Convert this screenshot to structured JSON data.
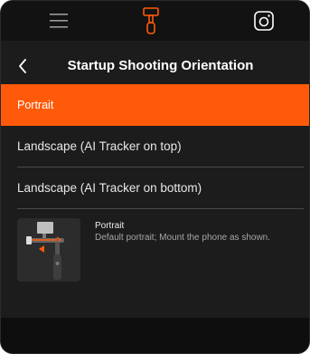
{
  "topbar": {
    "icons": [
      "menu-icon",
      "gimbal-icon",
      "camera-icon"
    ],
    "accent_color": "#ff5a0a"
  },
  "header": {
    "title": "Startup Shooting Orientation",
    "back_icon": "chevron-left-icon"
  },
  "options": [
    {
      "label": "Portrait",
      "selected": true
    },
    {
      "label": "Landscape (AI Tracker on top)",
      "selected": false
    },
    {
      "label": "Landscape (AI Tracker on bottom)",
      "selected": false
    }
  ],
  "preview": {
    "image": "gimbal-portrait-illustration",
    "title": "Portrait",
    "description": "Default portrait; Mount the phone as shown."
  },
  "colors": {
    "background": "#1c1c1c",
    "selected": "#ff5a0a",
    "divider": "#4a4a4a"
  }
}
